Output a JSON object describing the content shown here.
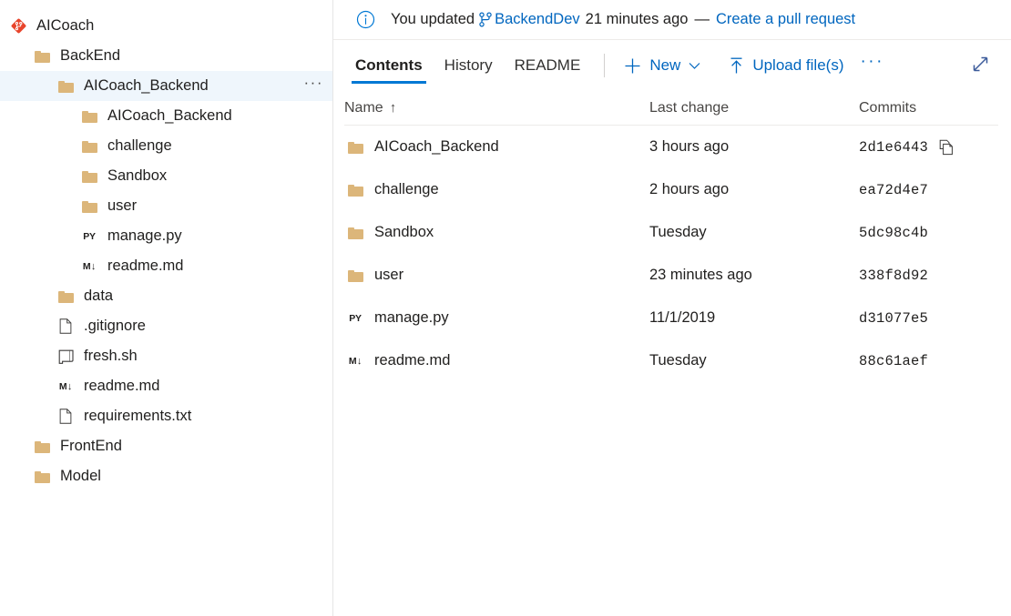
{
  "sidebar": {
    "items": [
      {
        "label": "AICoach",
        "icon": "repo-icon",
        "depth": 0,
        "selected": false,
        "menu": false
      },
      {
        "label": "BackEnd",
        "icon": "folder-icon",
        "depth": 1,
        "selected": false,
        "menu": false
      },
      {
        "label": "AICoach_Backend",
        "icon": "folder-icon",
        "depth": 2,
        "selected": true,
        "menu": true,
        "menu_label": "···"
      },
      {
        "label": "AICoach_Backend",
        "icon": "folder-icon",
        "depth": 3,
        "selected": false,
        "menu": false
      },
      {
        "label": "challenge",
        "icon": "folder-icon",
        "depth": 3,
        "selected": false,
        "menu": false
      },
      {
        "label": "Sandbox",
        "icon": "folder-icon",
        "depth": 3,
        "selected": false,
        "menu": false
      },
      {
        "label": "user",
        "icon": "folder-icon",
        "depth": 3,
        "selected": false,
        "menu": false
      },
      {
        "label": "manage.py",
        "icon": "python-file-icon",
        "depth": 3,
        "selected": false,
        "menu": false
      },
      {
        "label": "readme.md",
        "icon": "markdown-file-icon",
        "depth": 3,
        "selected": false,
        "menu": false
      },
      {
        "label": "data",
        "icon": "folder-icon",
        "depth": 2,
        "selected": false,
        "menu": false
      },
      {
        "label": ".gitignore",
        "icon": "file-icon",
        "depth": 2,
        "selected": false,
        "menu": false
      },
      {
        "label": "fresh.sh",
        "icon": "shell-file-icon",
        "depth": 2,
        "selected": false,
        "menu": false
      },
      {
        "label": "readme.md",
        "icon": "markdown-file-icon",
        "depth": 2,
        "selected": false,
        "menu": false
      },
      {
        "label": "requirements.txt",
        "icon": "file-icon",
        "depth": 2,
        "selected": false,
        "menu": false
      },
      {
        "label": "FrontEnd",
        "icon": "folder-icon",
        "depth": 1,
        "selected": false,
        "menu": false
      },
      {
        "label": "Model",
        "icon": "folder-icon",
        "depth": 1,
        "selected": false,
        "menu": false
      }
    ]
  },
  "banner": {
    "info_icon": "info-icon",
    "prefix": "You updated",
    "branch_icon": "branch-icon",
    "branch": "BackendDev",
    "time": "21 minutes ago",
    "dash": "—",
    "action_link": "Create a pull request"
  },
  "toolbar": {
    "tabs": [
      {
        "label": "Contents",
        "active": true
      },
      {
        "label": "History",
        "active": false
      },
      {
        "label": "README",
        "active": false
      }
    ],
    "new_label": "New",
    "new_icon": "plus-icon",
    "new_chevron_icon": "chevron-down-icon",
    "upload_label": "Upload file(s)",
    "upload_icon": "upload-icon",
    "more_label": "···",
    "expand_icon": "expand-diagonal-icon"
  },
  "table": {
    "headers": {
      "name": "Name",
      "name_sort": "↑",
      "last_change": "Last change",
      "commits": "Commits"
    },
    "rows": [
      {
        "name": "AICoach_Backend",
        "icon": "folder-icon",
        "last_change": "3 hours ago",
        "commit": "2d1e6443",
        "copy": true,
        "copy_icon": "copy-icon"
      },
      {
        "name": "challenge",
        "icon": "folder-icon",
        "last_change": "2 hours ago",
        "commit": "ea72d4e7",
        "copy": false
      },
      {
        "name": "Sandbox",
        "icon": "folder-icon",
        "last_change": "Tuesday",
        "commit": "5dc98c4b",
        "copy": false
      },
      {
        "name": "user",
        "icon": "folder-icon",
        "last_change": "23 minutes ago",
        "commit": "338f8d92",
        "copy": false
      },
      {
        "name": "manage.py",
        "icon": "python-file-icon",
        "last_change": "11/1/2019",
        "commit": "d31077e5",
        "copy": false
      },
      {
        "name": "readme.md",
        "icon": "markdown-file-icon",
        "last_change": "Tuesday",
        "commit": "88c61aef",
        "copy": false
      }
    ]
  },
  "colors": {
    "accent": "#0078d4",
    "link": "#0066bf",
    "folder": "#dcb67a",
    "selection": "#eff6fc",
    "repo_icon": "#e8452c"
  }
}
